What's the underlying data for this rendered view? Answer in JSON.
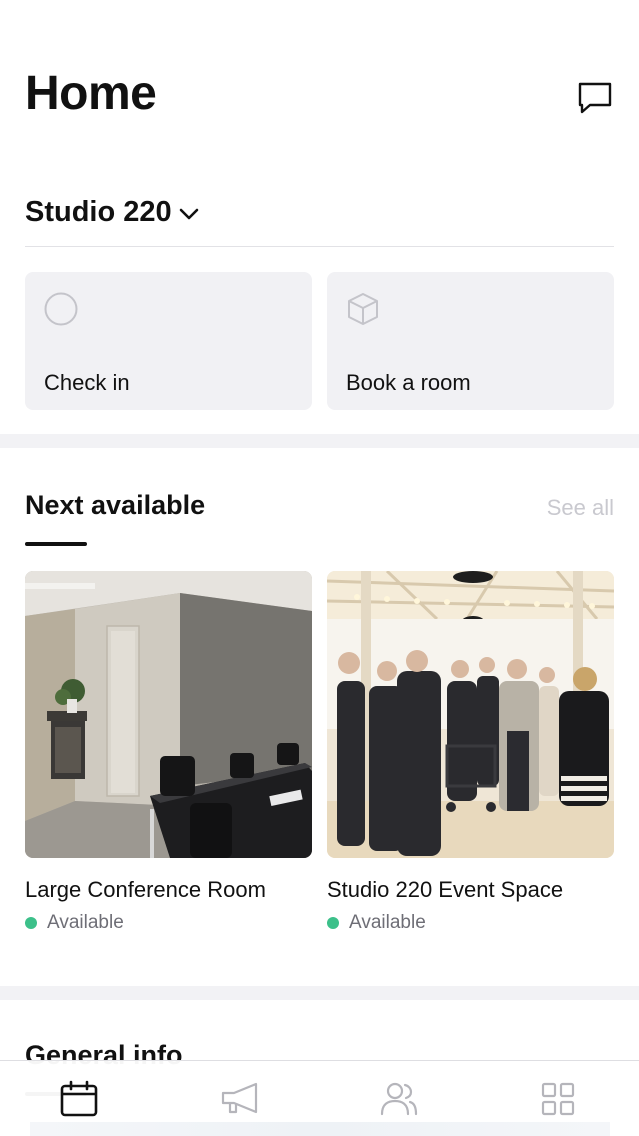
{
  "header": {
    "title": "Home",
    "chat_icon": "chat-bubble-icon"
  },
  "location": {
    "name": "Studio 220",
    "chevron_icon": "chevron-down-icon"
  },
  "actions": [
    {
      "label": "Check in",
      "icon": "circle-icon"
    },
    {
      "label": "Book a room",
      "icon": "cube-icon"
    }
  ],
  "next_available": {
    "title": "Next available",
    "see_all": "See all",
    "rooms": [
      {
        "name": "Large Conference Room",
        "status": "Available",
        "photo": "conference-room-photo"
      },
      {
        "name": "Studio 220 Event Space",
        "status": "Available",
        "photo": "event-space-photo"
      }
    ]
  },
  "general_info": {
    "title": "General info"
  },
  "tabbar": {
    "tabs": [
      {
        "icon": "calendar-icon",
        "active": true
      },
      {
        "icon": "megaphone-icon",
        "active": false
      },
      {
        "icon": "people-icon",
        "active": false
      },
      {
        "icon": "grid-icon",
        "active": false
      }
    ]
  },
  "colors": {
    "available": "#3cc08a",
    "card_bg": "#f1f1f4",
    "muted_text": "#6e6e76",
    "see_all": "#c9c9cf"
  }
}
